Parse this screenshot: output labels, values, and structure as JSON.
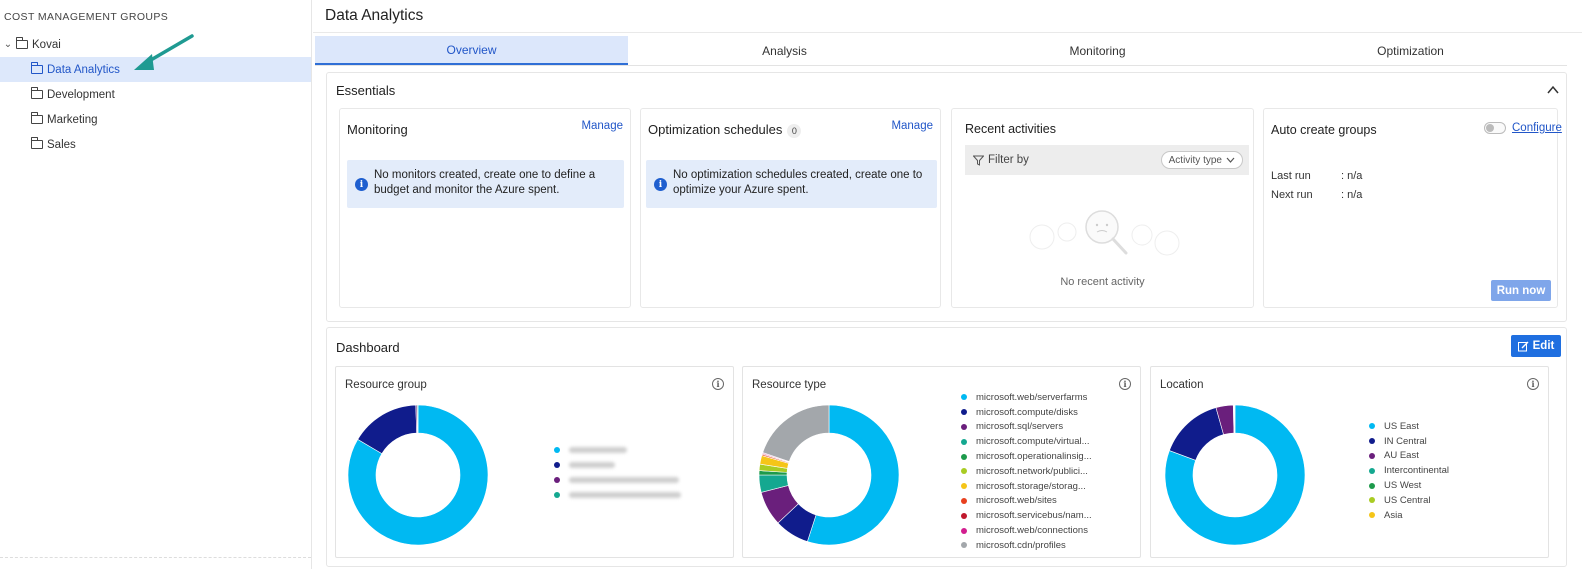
{
  "sidebar": {
    "title": "COST MANAGEMENT GROUPS",
    "root": {
      "label": "Kovai"
    },
    "items": [
      {
        "label": "Data Analytics",
        "selected": true
      },
      {
        "label": "Development"
      },
      {
        "label": "Marketing"
      },
      {
        "label": "Sales"
      }
    ]
  },
  "header": {
    "title": "Data Analytics"
  },
  "tabs": [
    {
      "label": "Overview",
      "active": true
    },
    {
      "label": "Analysis"
    },
    {
      "label": "Monitoring"
    },
    {
      "label": "Optimization"
    }
  ],
  "essentials": {
    "title": "Essentials",
    "monitoring": {
      "title": "Monitoring",
      "manage": "Manage",
      "info": "No monitors created, create one to define a budget and monitor the Azure spent."
    },
    "optimization": {
      "title": "Optimization schedules",
      "count": "0",
      "manage": "Manage",
      "info": "No optimization schedules created, create one to optimize your Azure spent."
    },
    "recent": {
      "title": "Recent activities",
      "filter_label": "Filter by",
      "activity_select": "Activity type",
      "empty": "No recent activity"
    },
    "auto_create": {
      "title": "Auto create groups",
      "configure": "Configure",
      "last_run_label": "Last run",
      "last_run_value": ": n/a",
      "next_run_label": "Next run",
      "next_run_value": ": n/a",
      "run_now": "Run now"
    }
  },
  "dashboard": {
    "title": "Dashboard",
    "edit": "Edit",
    "colors": {
      "cyan": "#00b9f2",
      "navy": "#101c8c",
      "purple": "#6a1f7c",
      "teal": "#14a890",
      "green": "#1d9a4b",
      "lime": "#a9cc23",
      "yellow": "#f5c518",
      "red": "#e8401e",
      "darkred": "#c0182d",
      "magenta": "#d21d8f",
      "gray": "#a3a7ab"
    },
    "widgets": [
      {
        "title": "Resource group",
        "legend_blurred": true,
        "slices": [
          {
            "color": "#00b9f2",
            "value": 83.5
          },
          {
            "color": "#101c8c",
            "value": 16.0
          },
          {
            "color": "#6a1f7c",
            "value": 0.3
          },
          {
            "color": "#14a890",
            "value": 0.2
          }
        ],
        "legend": [
          {
            "color": "#00b9f2"
          },
          {
            "color": "#101c8c"
          },
          {
            "color": "#6a1f7c"
          },
          {
            "color": "#14a890"
          }
        ]
      },
      {
        "title": "Resource type",
        "slices": [
          {
            "color": "#00b9f2",
            "value": 55
          },
          {
            "color": "#101c8c",
            "value": 8
          },
          {
            "color": "#6a1f7c",
            "value": 8
          },
          {
            "color": "#14a890",
            "value": 4
          },
          {
            "color": "#1d9a4b",
            "value": 1
          },
          {
            "color": "#a9cc23",
            "value": 1.5
          },
          {
            "color": "#f5c518",
            "value": 2
          },
          {
            "color": "#e8401e",
            "value": 0.3
          },
          {
            "color": "#c0182d",
            "value": 0.2
          },
          {
            "color": "#d21d8f",
            "value": 0.2
          },
          {
            "color": "#a3a7ab",
            "value": 19.8
          }
        ],
        "legend": [
          {
            "label": "microsoft.web/serverfarms",
            "color": "#00b9f2"
          },
          {
            "label": "microsoft.compute/disks",
            "color": "#101c8c"
          },
          {
            "label": "microsoft.sql/servers",
            "color": "#6a1f7c"
          },
          {
            "label": "microsoft.compute/virtual...",
            "color": "#14a890"
          },
          {
            "label": "microsoft.operationalinsig...",
            "color": "#1d9a4b"
          },
          {
            "label": "microsoft.network/publici...",
            "color": "#a9cc23"
          },
          {
            "label": "microsoft.storage/storag...",
            "color": "#f5c518"
          },
          {
            "label": "microsoft.web/sites",
            "color": "#e8401e"
          },
          {
            "label": "microsoft.servicebus/nam...",
            "color": "#c0182d"
          },
          {
            "label": "microsoft.web/connections",
            "color": "#d21d8f"
          },
          {
            "label": "microsoft.cdn/profiles",
            "color": "#a3a7ab"
          }
        ]
      },
      {
        "title": "Location",
        "slices": [
          {
            "color": "#00b9f2",
            "value": 81
          },
          {
            "color": "#101c8c",
            "value": 15
          },
          {
            "color": "#6a1f7c",
            "value": 4
          },
          {
            "color": "#14a890",
            "value": 0.1
          },
          {
            "color": "#1d9a4b",
            "value": 0.1
          },
          {
            "color": "#a9cc23",
            "value": 0.1
          },
          {
            "color": "#f5c518",
            "value": 0.1
          }
        ],
        "legend": [
          {
            "label": "US East",
            "color": "#00b9f2"
          },
          {
            "label": "IN Central",
            "color": "#101c8c"
          },
          {
            "label": "AU East",
            "color": "#6a1f7c"
          },
          {
            "label": "Intercontinental",
            "color": "#14a890"
          },
          {
            "label": "US West",
            "color": "#1d9a4b"
          },
          {
            "label": "US Central",
            "color": "#a9cc23"
          },
          {
            "label": "Asia",
            "color": "#f5c518"
          }
        ]
      }
    ]
  }
}
